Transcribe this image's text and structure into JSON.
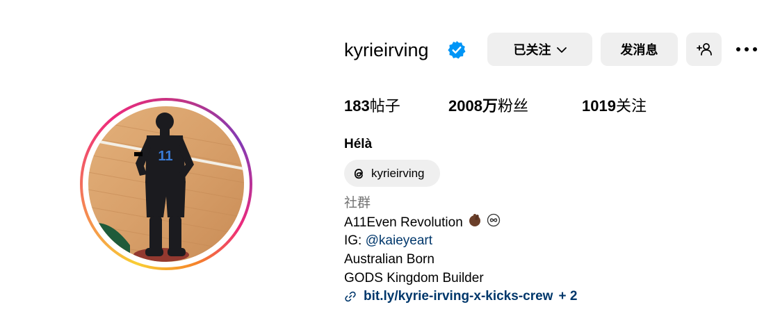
{
  "profile": {
    "username": "kyrieirving",
    "full_name": "Hélà",
    "threads_handle": "kyrieirving",
    "category": "社群"
  },
  "actions": {
    "following_label": "已关注",
    "message_label": "发消息"
  },
  "stats": {
    "posts_count": "183",
    "posts_label": "帖子",
    "followers_count": "2008万",
    "followers_label": "粉丝",
    "following_count": "1019",
    "following_label": "关注"
  },
  "bio": {
    "line1": "A11Even Revolution",
    "line2_prefix": "IG: ",
    "line2_mention": "@kaieyeart",
    "line3": "Australian Born",
    "line4": "GODS Kingdom Builder"
  },
  "link": {
    "url_text": "bit.ly/kyrie-irving-x-kicks-crew",
    "extra": "+ 2"
  },
  "colors": {
    "verified_badge": "#0095f6",
    "button_bg": "#efefef",
    "link_color": "#00376b",
    "category_color": "#737373"
  },
  "icons": {
    "verified": "verified-badge-icon",
    "chevron": "chevron-down-icon",
    "suggest": "add-person-icon",
    "more": "more-options-icon",
    "threads": "threads-icon",
    "link": "link-icon"
  }
}
